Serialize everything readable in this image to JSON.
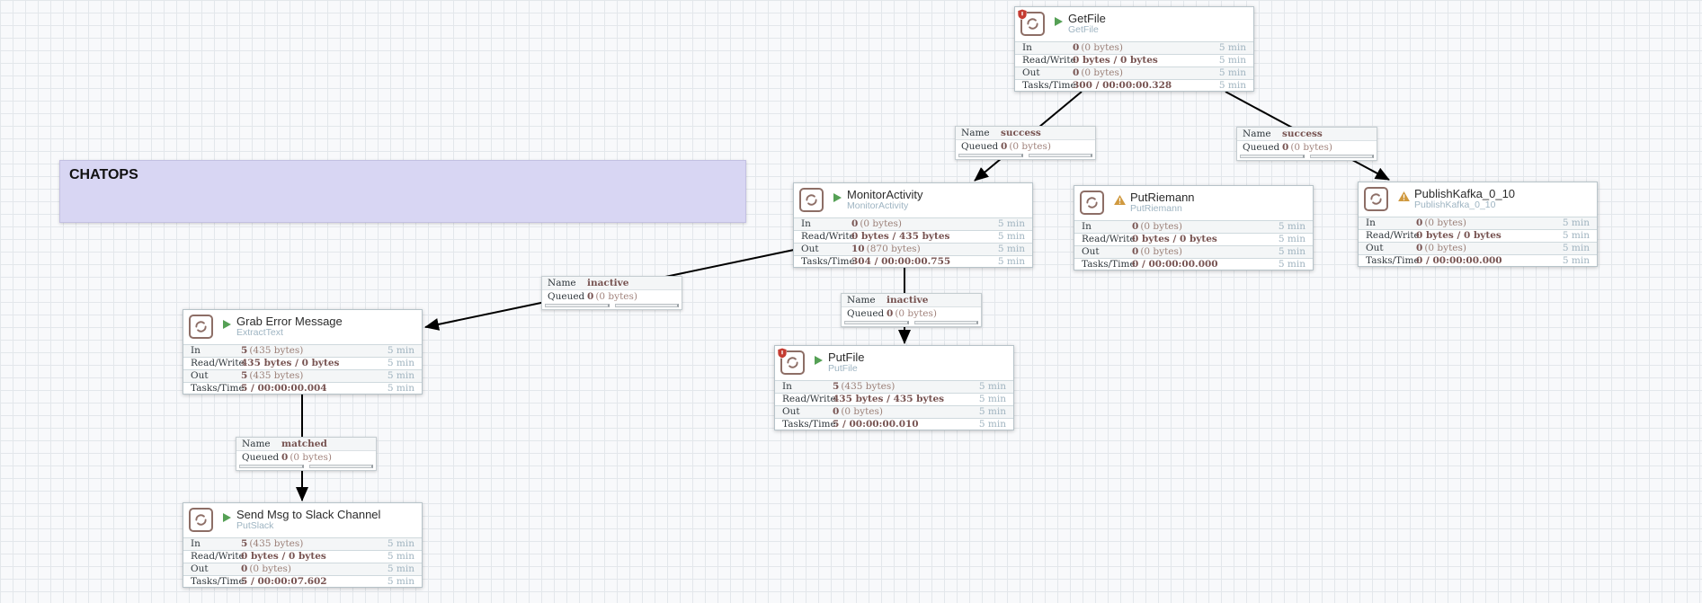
{
  "chatops_label": {
    "text": "CHATOPS"
  },
  "colors": {
    "running_green": "#55a055",
    "invalid_yellow": "#d0993f",
    "restricted_red": "#c43b31",
    "stat_value_brown": "#775351",
    "label_lavender": "#d8d6f3",
    "connection_black": "#000000"
  },
  "processors": [
    {
      "title": "GetFile",
      "type": "GetFile",
      "rows": [
        {
          "label": "In",
          "value": "0",
          "detail": "(0 bytes)",
          "window": "5 min"
        },
        {
          "label": "Read/Write",
          "value": "0 bytes / 0 bytes",
          "detail": "",
          "window": "5 min"
        },
        {
          "label": "Out",
          "value": "0",
          "detail": "(0 bytes)",
          "window": "5 min"
        },
        {
          "label": "Tasks/Time",
          "value": "300 / 00:00:00.328",
          "detail": "",
          "window": "5 min"
        }
      ]
    },
    {
      "title": "MonitorActivity",
      "type": "MonitorActivity",
      "rows": [
        {
          "label": "In",
          "value": "0",
          "detail": "(0 bytes)",
          "window": "5 min"
        },
        {
          "label": "Read/Write",
          "value": "0 bytes / 435 bytes",
          "detail": "",
          "window": "5 min"
        },
        {
          "label": "Out",
          "value": "10",
          "detail": "(870 bytes)",
          "window": "5 min"
        },
        {
          "label": "Tasks/Time",
          "value": "304 / 00:00:00.755",
          "detail": "",
          "window": "5 min"
        }
      ]
    },
    {
      "title": "PutRiemann",
      "type": "PutRiemann",
      "rows": [
        {
          "label": "In",
          "value": "0",
          "detail": "(0 bytes)",
          "window": "5 min"
        },
        {
          "label": "Read/Write",
          "value": "0 bytes / 0 bytes",
          "detail": "",
          "window": "5 min"
        },
        {
          "label": "Out",
          "value": "0",
          "detail": "(0 bytes)",
          "window": "5 min"
        },
        {
          "label": "Tasks/Time",
          "value": "0 / 00:00:00.000",
          "detail": "",
          "window": "5 min"
        }
      ]
    },
    {
      "title": "PublishKafka_0_10",
      "type": "PublishKafka_0_10",
      "rows": [
        {
          "label": "In",
          "value": "0",
          "detail": "(0 bytes)",
          "window": "5 min"
        },
        {
          "label": "Read/Write",
          "value": "0 bytes / 0 bytes",
          "detail": "",
          "window": "5 min"
        },
        {
          "label": "Out",
          "value": "0",
          "detail": "(0 bytes)",
          "window": "5 min"
        },
        {
          "label": "Tasks/Time",
          "value": "0 / 00:00:00.000",
          "detail": "",
          "window": "5 min"
        }
      ]
    },
    {
      "title": "Grab Error Message",
      "type": "ExtractText",
      "rows": [
        {
          "label": "In",
          "value": "5",
          "detail": "(435 bytes)",
          "window": "5 min"
        },
        {
          "label": "Read/Write",
          "value": "435 bytes / 0 bytes",
          "detail": "",
          "window": "5 min"
        },
        {
          "label": "Out",
          "value": "5",
          "detail": "(435 bytes)",
          "window": "5 min"
        },
        {
          "label": "Tasks/Time",
          "value": "5 / 00:00:00.004",
          "detail": "",
          "window": "5 min"
        }
      ]
    },
    {
      "title": "PutFile",
      "type": "PutFile",
      "rows": [
        {
          "label": "In",
          "value": "5",
          "detail": "(435 bytes)",
          "window": "5 min"
        },
        {
          "label": "Read/Write",
          "value": "435 bytes / 435 bytes",
          "detail": "",
          "window": "5 min"
        },
        {
          "label": "Out",
          "value": "0",
          "detail": "(0 bytes)",
          "window": "5 min"
        },
        {
          "label": "Tasks/Time",
          "value": "5 / 00:00:00.010",
          "detail": "",
          "window": "5 min"
        }
      ]
    },
    {
      "title": "Send Msg to Slack Channel",
      "type": "PutSlack",
      "rows": [
        {
          "label": "In",
          "value": "5",
          "detail": "(435 bytes)",
          "window": "5 min"
        },
        {
          "label": "Read/Write",
          "value": "0 bytes / 0 bytes",
          "detail": "",
          "window": "5 min"
        },
        {
          "label": "Out",
          "value": "0",
          "detail": "(0 bytes)",
          "window": "5 min"
        },
        {
          "label": "Tasks/Time",
          "value": "5 / 00:00:07.602",
          "detail": "",
          "window": "5 min"
        }
      ]
    }
  ],
  "connections": [
    {
      "name_label": "Name",
      "name": "success",
      "queued_label": "Queued",
      "queued_count": "0",
      "queued_size": "(0 bytes)"
    },
    {
      "name_label": "Name",
      "name": "success",
      "queued_label": "Queued",
      "queued_count": "0",
      "queued_size": "(0 bytes)"
    },
    {
      "name_label": "Name",
      "name": "inactive",
      "queued_label": "Queued",
      "queued_count": "0",
      "queued_size": "(0 bytes)"
    },
    {
      "name_label": "Name",
      "name": "inactive",
      "queued_label": "Queued",
      "queued_count": "0",
      "queued_size": "(0 bytes)"
    },
    {
      "name_label": "Name",
      "name": "matched",
      "queued_label": "Queued",
      "queued_count": "0",
      "queued_size": "(0 bytes)"
    }
  ]
}
